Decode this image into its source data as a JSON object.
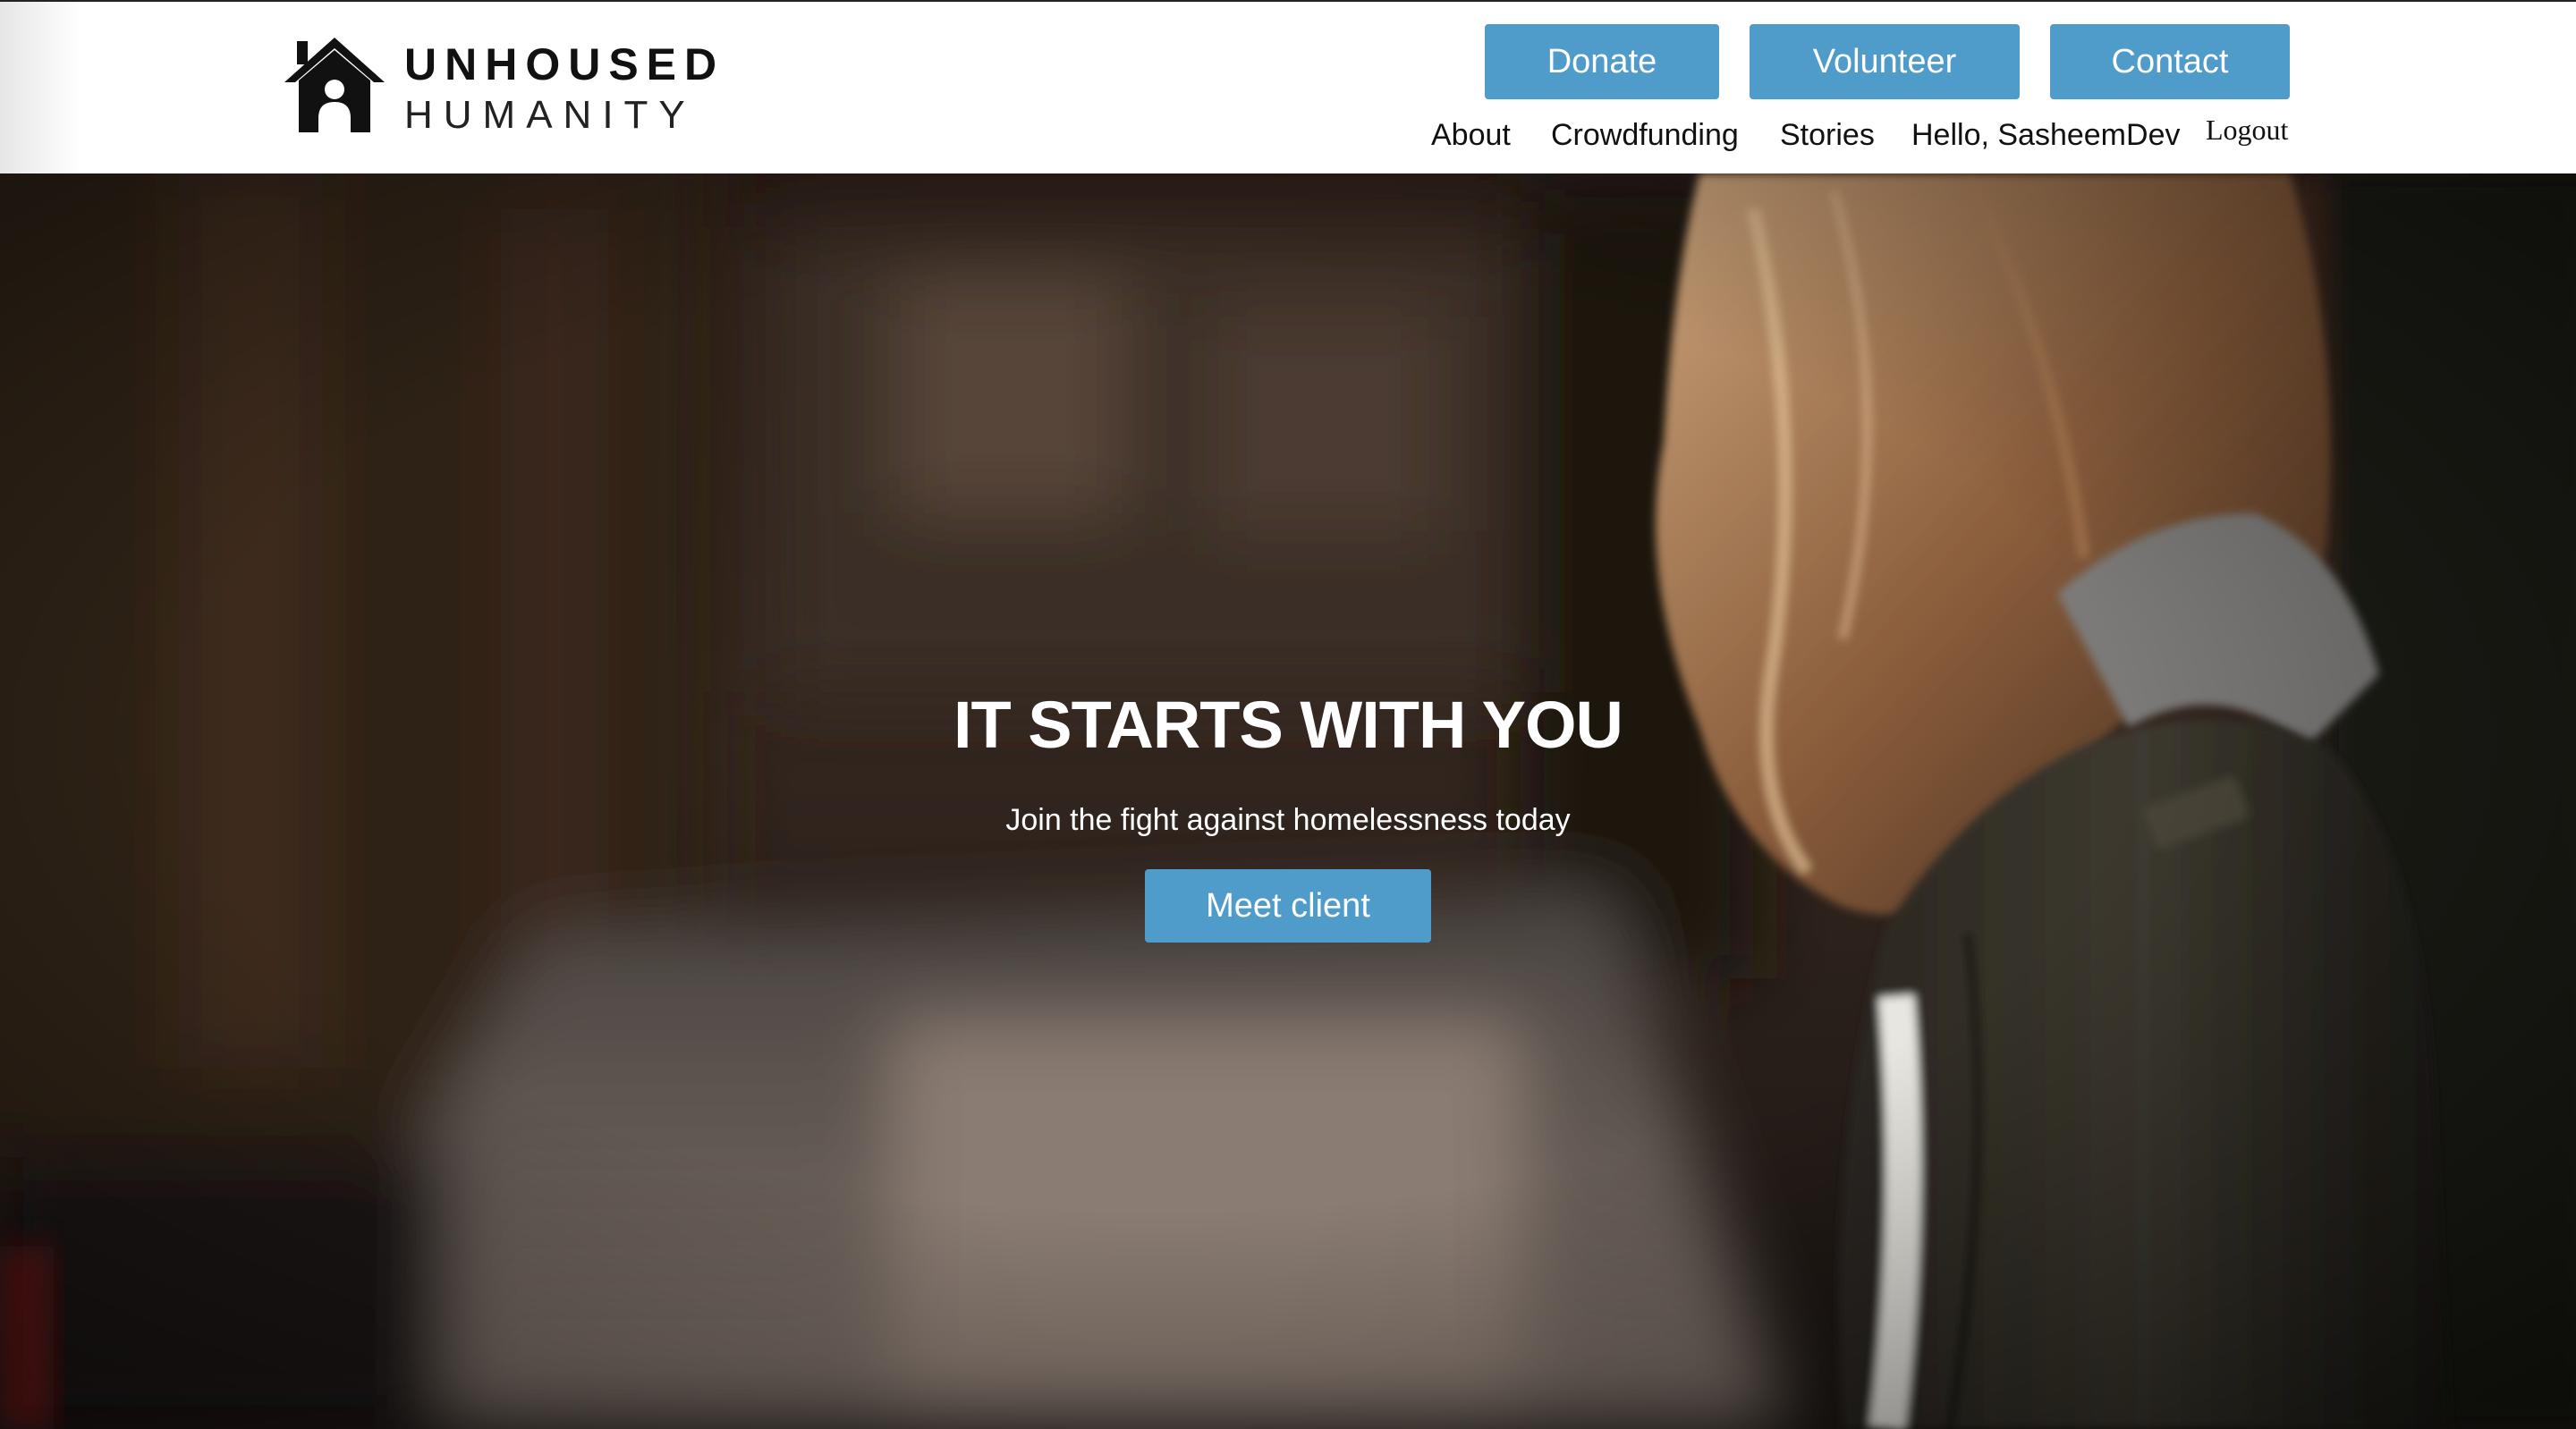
{
  "header": {
    "logo": {
      "line1": "UNHOUSED",
      "line2": "HUMANITY",
      "icon": "house-person-icon"
    },
    "buttons": {
      "donate": "Donate",
      "volunteer": "Volunteer",
      "contact": "Contact"
    },
    "nav": {
      "about": "About",
      "crowdfunding": "Crowdfunding",
      "stories": "Stories",
      "greeting": "Hello, SasheemDev",
      "logout": "Logout"
    }
  },
  "hero": {
    "title": "IT STARTS WITH YOU",
    "subtitle": "Join the fight against homelessness today",
    "cta": "Meet client",
    "image": "sad-woman-hooded-jacket-photo"
  },
  "colors": {
    "accent": "#4f9ccb",
    "header_bg": "#ffffff",
    "hero_text": "#ffffff"
  }
}
